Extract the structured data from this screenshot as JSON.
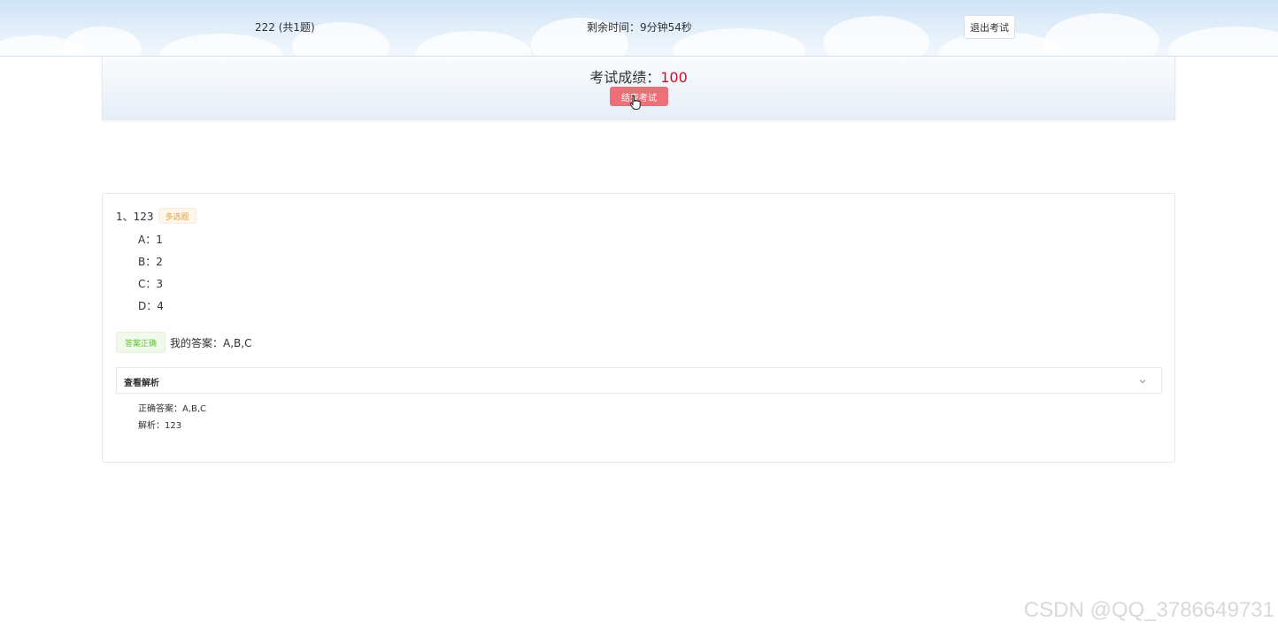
{
  "header": {
    "exam_title": "222 (共1题)",
    "timer": "剩余时间：9分钟54秒",
    "exit_label": "退出考试"
  },
  "score_panel": {
    "score_label": "考试成绩：",
    "score_value": "100",
    "end_label": "结束考试",
    "end_button_color": "#ef6f79",
    "score_color": "#c0142c"
  },
  "question": {
    "number_title": "1、123",
    "type_tag": "多选题",
    "options": [
      {
        "key": "A：",
        "text": "1"
      },
      {
        "key": "B：",
        "text": "2"
      },
      {
        "key": "C：",
        "text": "3"
      },
      {
        "key": "D：",
        "text": "4"
      }
    ],
    "result_tag": "答案正确",
    "my_answer": "我的答案：A,B,C",
    "analysis_toggle": "查看解析",
    "correct_answer": "正确答案：A,B,C",
    "analysis": "解析：123"
  },
  "watermark": "CSDN @QQ_3786649731",
  "icons": {
    "cursor": "hand-pointer-icon",
    "collapse": "chevron-down-icon"
  }
}
